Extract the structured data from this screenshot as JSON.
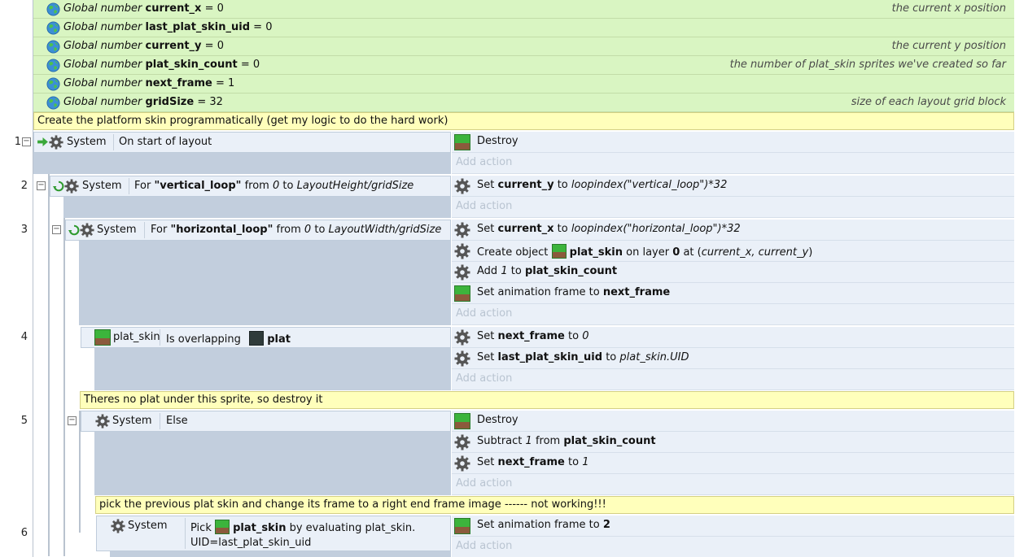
{
  "globals": [
    {
      "prefix": "Global number",
      "name": "current_x",
      "value": "= 0",
      "comment": "the current x position"
    },
    {
      "prefix": "Global number",
      "name": "last_plat_skin_uid",
      "value": "= 0",
      "comment": ""
    },
    {
      "prefix": "Global number",
      "name": "current_y",
      "value": "= 0",
      "comment": "the current y position"
    },
    {
      "prefix": "Global number",
      "name": "plat_skin_count",
      "value": "= 0",
      "comment": "the number of plat_skin sprites we've created so far"
    },
    {
      "prefix": "Global number",
      "name": "next_frame",
      "value": "= 1",
      "comment": ""
    },
    {
      "prefix": "Global number",
      "name": "gridSize",
      "value": "= 32",
      "comment": "size of each layout grid block"
    }
  ],
  "comments": {
    "c1": "Create the platform skin programmatically (get my logic to do the hard work)",
    "c2": "Theres no plat under this sprite, so destroy it",
    "c3": "pick the previous plat skin and change its frame to a right end frame image ------ not working!!!"
  },
  "add_action": "Add action",
  "events": {
    "e1": {
      "num": "1",
      "object": "System",
      "condition": "On start of layout",
      "a1": "Destroy"
    },
    "e2": {
      "num": "2",
      "object": "System",
      "for": "For",
      "loop": "\"vertical_loop\"",
      "from": "from",
      "start": "0",
      "to": "to",
      "end": "LayoutHeight/gridSize",
      "a1_verb": "Set",
      "a1_var": "current_y",
      "a1_to": "to",
      "a1_expr": "loopindex(\"vertical_loop\")*32"
    },
    "e3": {
      "num": "3",
      "object": "System",
      "for": "For",
      "loop": "\"horizontal_loop\"",
      "from": "from",
      "start": "0",
      "to": "to",
      "end": "LayoutWidth/gridSize",
      "a1_verb": "Set",
      "a1_var": "current_x",
      "a1_to": "to",
      "a1_expr": "loopindex(\"horizontal_loop\")*32",
      "a2_verb": "Create object",
      "a2_obj": "plat_skin",
      "a2_on": "on layer",
      "a2_layer": "0",
      "a2_at": "at (",
      "a2_x": "current_x",
      "a2_comma": ", ",
      "a2_y": "current_y",
      "a2_close": ")",
      "a3_verb": "Add",
      "a3_n": "1",
      "a3_to": "to",
      "a3_var": "plat_skin_count",
      "a4_verb": "Set animation frame to",
      "a4_val": "next_frame"
    },
    "e4": {
      "num": "4",
      "object": "plat_skin",
      "condition": "Is overlapping",
      "target": "plat",
      "a1_verb": "Set",
      "a1_var": "next_frame",
      "a1_to": "to",
      "a1_val": "0",
      "a2_verb": "Set",
      "a2_var": "last_plat_skin_uid",
      "a2_to": "to",
      "a2_val": "plat_skin.UID"
    },
    "e5": {
      "num": "5",
      "object": "System",
      "condition": "Else",
      "a1": "Destroy",
      "a2_verb": "Subtract",
      "a2_n": "1",
      "a2_from": "from",
      "a2_var": "plat_skin_count",
      "a3_verb": "Set",
      "a3_var": "next_frame",
      "a3_to": "to",
      "a3_val": "1"
    },
    "e6": {
      "num": "6",
      "object": "System",
      "pick": "Pick",
      "pick_obj": "plat_skin",
      "pick_rest": "by evaluating plat_skin.",
      "pick_line2": "UID=last_plat_skin_uid",
      "a1_verb": "Set animation frame to",
      "a1_val": "2"
    }
  },
  "icons": {
    "globe": "globe-icon",
    "gear": "gear-icon",
    "loop": "loop-icon",
    "start": "start-arrow-icon",
    "sprite": "plat-skin-sprite-icon",
    "plat": "plat-sprite-icon"
  }
}
